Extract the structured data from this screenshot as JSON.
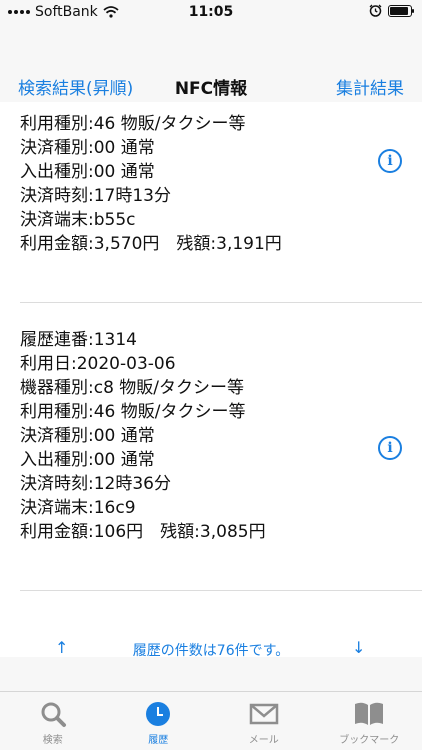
{
  "status_bar": {
    "carrier": "SoftBank",
    "time": "11:05",
    "battery_level": 0.9
  },
  "nav": {
    "back_label": "検索結果(昇順)",
    "title": "NFC情報",
    "right_label": "集計結果"
  },
  "records": [
    {
      "lines": [
        "利用種別:46 物販/タクシー等",
        "決済種別:00 通常",
        "入出種別:00 通常",
        "決済時刻:17時13分",
        "決済端末:b55c",
        "利用金額:3,570円　残額:3,191円"
      ]
    },
    {
      "lines": [
        "履歴連番:1314",
        "利用日:2020-03-06",
        "機器種別:c8 物販/タクシー等",
        "利用種別:46 物販/タクシー等",
        "決済種別:00 通常",
        "入出種別:00 通常",
        "決済時刻:12時36分",
        "決済端末:16c9",
        "利用金額:106円　残額:3,085円"
      ]
    }
  ],
  "pager": {
    "up": "↑",
    "count_text": "履歴の件数は76件です。",
    "down": "↓"
  },
  "tabs": [
    {
      "label": "検索",
      "icon": "search-icon",
      "active": false
    },
    {
      "label": "履歴",
      "icon": "clock-icon",
      "active": true
    },
    {
      "label": "メール",
      "icon": "mail-icon",
      "active": false
    },
    {
      "label": "ブックマーク",
      "icon": "book-icon",
      "active": false
    }
  ],
  "colors": {
    "accent": "#1a7fe0",
    "inactive": "#8e8e8e"
  }
}
